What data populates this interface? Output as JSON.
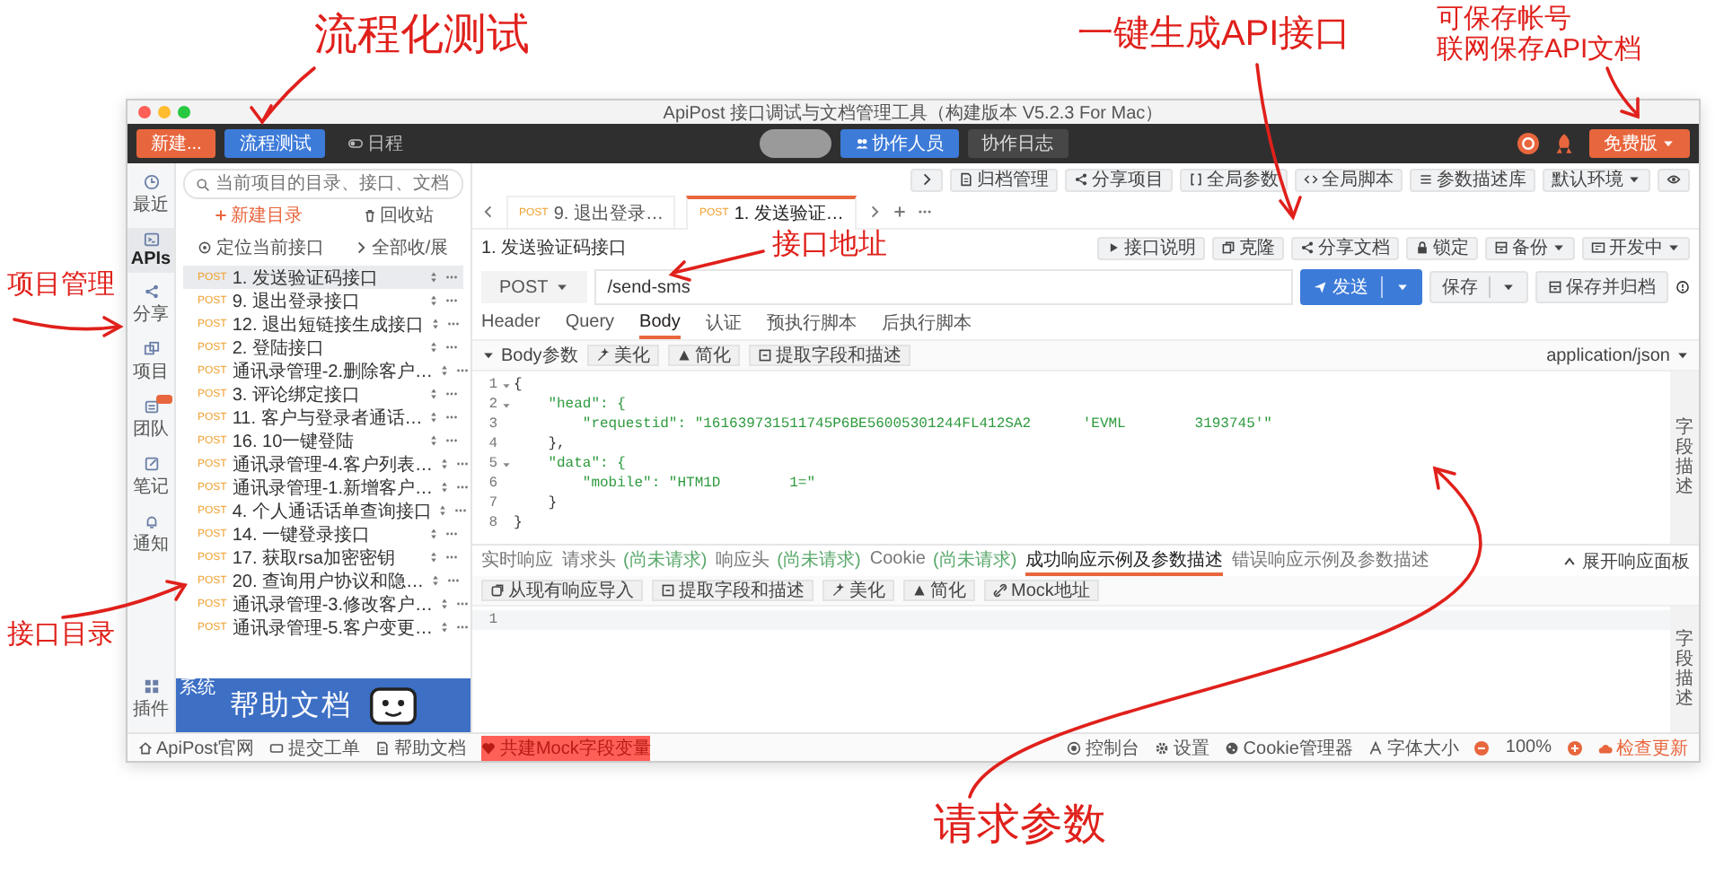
{
  "annotations": [
    {
      "lines": [
        "流程化测试"
      ]
    },
    {
      "lines": [
        "一键生成API接口"
      ]
    },
    {
      "lines": [
        "可保存帐号",
        "联网保存API文档"
      ]
    },
    {
      "lines": [
        "项目管理"
      ]
    },
    {
      "lines": [
        "接口地址"
      ]
    },
    {
      "lines": [
        "接口目录"
      ]
    },
    {
      "lines": [
        "请求参数"
      ]
    }
  ],
  "window": {
    "title": "ApiPost 接口调试与文档管理工具（构建版本 V5.2.3 For Mac）"
  },
  "toolbar": {
    "buttons": [
      {
        "label": "新建...",
        "kind": "orange"
      },
      {
        "label": "流程测试",
        "kind": "blue"
      },
      {
        "label": "日程",
        "kind": "plain"
      }
    ],
    "collab": [
      {
        "label": "协作人员",
        "kind": "blue"
      },
      {
        "label": "协作日志",
        "kind": "dark"
      }
    ],
    "plan": "免费版"
  },
  "rail": {
    "items": [
      {
        "label": "最近",
        "selected": false,
        "badge": false
      },
      {
        "label": "APIs",
        "selected": true,
        "badge": false
      },
      {
        "label": "分享",
        "selected": false,
        "badge": false
      },
      {
        "label": "项目",
        "selected": false,
        "badge": false
      },
      {
        "label": "团队",
        "selected": false,
        "badge": true
      },
      {
        "label": "笔记",
        "selected": false,
        "badge": false
      },
      {
        "label": "通知",
        "selected": false,
        "badge": false
      }
    ],
    "bottom": "插件"
  },
  "sidebar": {
    "search": {
      "placeholder": "当前项目的目录、接口、文档"
    },
    "new_folder": "新建目录",
    "recycle": "回收站",
    "locate": "定位当前接口",
    "toggle_all": "全部收/展",
    "items": [
      {
        "method": "POST",
        "name": "1. 发送验证码接口",
        "selected": true
      },
      {
        "method": "POST",
        "name": "9. 退出登录接口",
        "selected": false
      },
      {
        "method": "POST",
        "name": "12. 退出短链接生成接口",
        "selected": false
      },
      {
        "method": "POST",
        "name": "2. 登陆接口",
        "selected": false
      },
      {
        "method": "POST",
        "name": "通讯录管理-2.删除客户…",
        "selected": false
      },
      {
        "method": "POST",
        "name": "3. 评论绑定接口",
        "selected": false
      },
      {
        "method": "POST",
        "name": "11. 客户与登录者通话…",
        "selected": false
      },
      {
        "method": "POST",
        "name": "16. 10一键登陆",
        "selected": false
      },
      {
        "method": "POST",
        "name": "通讯录管理-4.客户列表…",
        "selected": false
      },
      {
        "method": "POST",
        "name": "通讯录管理-1.新增客户…",
        "selected": false
      },
      {
        "method": "POST",
        "name": "4. 个人通话话单查询接口",
        "selected": false
      },
      {
        "method": "POST",
        "name": "14. 一键登录接口",
        "selected": false
      },
      {
        "method": "POST",
        "name": "17. 获取rsa加密密钥",
        "selected": false
      },
      {
        "method": "POST",
        "name": "20. 查询用户协议和隐…",
        "selected": false
      },
      {
        "method": "POST",
        "name": "通讯录管理-3.修改客户…",
        "selected": false
      },
      {
        "method": "POST",
        "name": "通讯录管理-5.客户变更…",
        "selected": false
      }
    ],
    "banner": {
      "tag": "系统",
      "title": "帮助文档"
    }
  },
  "main": {
    "top_actions": [
      "归档管理",
      "分享项目",
      "全局参数",
      "全局脚本",
      "参数描述库"
    ],
    "environment": "默认环境",
    "tabs": [
      {
        "method": "POST",
        "name": "9. 退出登录…",
        "selected": false
      },
      {
        "method": "POST",
        "name": "1. 发送验证…",
        "selected": true
      }
    ],
    "breadcrumb": "1. 发送验证码接口",
    "actions": [
      {
        "label": "接口说明",
        "kind": "plain"
      },
      {
        "label": "克隆",
        "kind": "plain"
      },
      {
        "label": "分享文档",
        "kind": "plain"
      },
      {
        "label": "锁定",
        "kind": "plain"
      },
      {
        "label": "备份",
        "kind": "dropdown"
      },
      {
        "label": "开发中",
        "kind": "dropdown"
      }
    ],
    "url": {
      "method": "POST",
      "value": "/send-sms"
    },
    "send": "发送",
    "save": "保存",
    "save_archive": "保存并归档",
    "request_tabs": [
      {
        "label": "Header",
        "selected": false
      },
      {
        "label": "Query",
        "selected": false
      },
      {
        "label": "Body",
        "selected": true
      },
      {
        "label": "认证",
        "selected": false
      },
      {
        "label": "预执行脚本",
        "selected": false
      },
      {
        "label": "后执行脚本",
        "selected": false
      }
    ],
    "body_label": "Body参数",
    "body_tools": [
      "美化",
      "简化",
      "提取字段和描述"
    ],
    "content_type": "application/json",
    "code": [
      {
        "no": "1",
        "fold": true,
        "kind": "punct",
        "text": "{"
      },
      {
        "no": "2",
        "fold": true,
        "kind": "string",
        "text": "    \"head\": {"
      },
      {
        "no": "3",
        "fold": false,
        "kind": "string",
        "text": "        \"requestid\": \"161639731511745P6BE56005301244FL412SA2      'EVML        3193745'\""
      },
      {
        "no": "4",
        "fold": false,
        "kind": "punct",
        "text": "    },"
      },
      {
        "no": "5",
        "fold": true,
        "kind": "string",
        "text": "    \"data\": {"
      },
      {
        "no": "6",
        "fold": false,
        "kind": "string",
        "text": "        \"mobile\": \"HTM1D        1=\""
      },
      {
        "no": "7",
        "fold": false,
        "kind": "punct",
        "text": "    }"
      },
      {
        "no": "8",
        "fold": false,
        "kind": "punct",
        "text": "}"
      }
    ],
    "field_panel": "字段描述",
    "response_tabs": [
      {
        "label": "实时响应",
        "selected": false
      },
      {
        "label": "请求头",
        "note": "(尚未请求)",
        "selected": false
      },
      {
        "label": "响应头",
        "note": "(尚未请求)",
        "selected": false
      },
      {
        "label": "Cookie",
        "note": "(尚未请求)",
        "selected": false
      },
      {
        "label": "成功响应示例及参数描述",
        "selected": true
      },
      {
        "label": "错误响应示例及参数描述",
        "selected": false
      }
    ],
    "response_expand": "展开响应面板",
    "response_tools": [
      "从现有响应导入",
      "提取字段和描述",
      "美化",
      "简化",
      "Mock地址"
    ],
    "response_code": [
      {
        "no": "1"
      }
    ],
    "response_field_panel": "字段描述"
  },
  "status_bar": {
    "left": [
      {
        "label": "ApiPost官网",
        "kind": "plain"
      },
      {
        "label": "提交工单",
        "kind": "plain"
      },
      {
        "label": "帮助文档",
        "kind": "plain"
      },
      {
        "label": "共建Mock字段变量",
        "kind": "highlight"
      }
    ],
    "right": [
      "控制台",
      "设置",
      "Cookie管理器",
      "字体大小"
    ],
    "zoom": "100%",
    "update": "检查更新"
  }
}
